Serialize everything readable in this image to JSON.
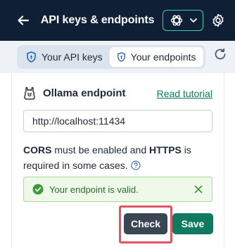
{
  "header": {
    "title": "API keys & endpoints",
    "back_icon": "arrow-left-icon",
    "model_icon": "openai-logo-icon",
    "settings_icon": "gear-icon",
    "accent_color": "#35d0a8",
    "background_color": "#0f1f35"
  },
  "tabs": [
    {
      "label": "Your API keys",
      "icon": "shield-icon",
      "active": false
    },
    {
      "label": "Your endpoints",
      "icon": "shield-icon",
      "active": true
    }
  ],
  "endpoint": {
    "title": "Ollama endpoint",
    "tutorial_link": "Read tutorial",
    "url_value": "http://localhost:11434",
    "note_bold_1": "CORS",
    "note_text_1": " must be enabled and ",
    "note_bold_2": "HTTPS",
    "note_text_2": " is required in some cases."
  },
  "alert": {
    "text": "Your endpoint is valid.",
    "color": "#2f6b2a"
  },
  "buttons": {
    "check_label": "Check",
    "save_label": "Save"
  }
}
